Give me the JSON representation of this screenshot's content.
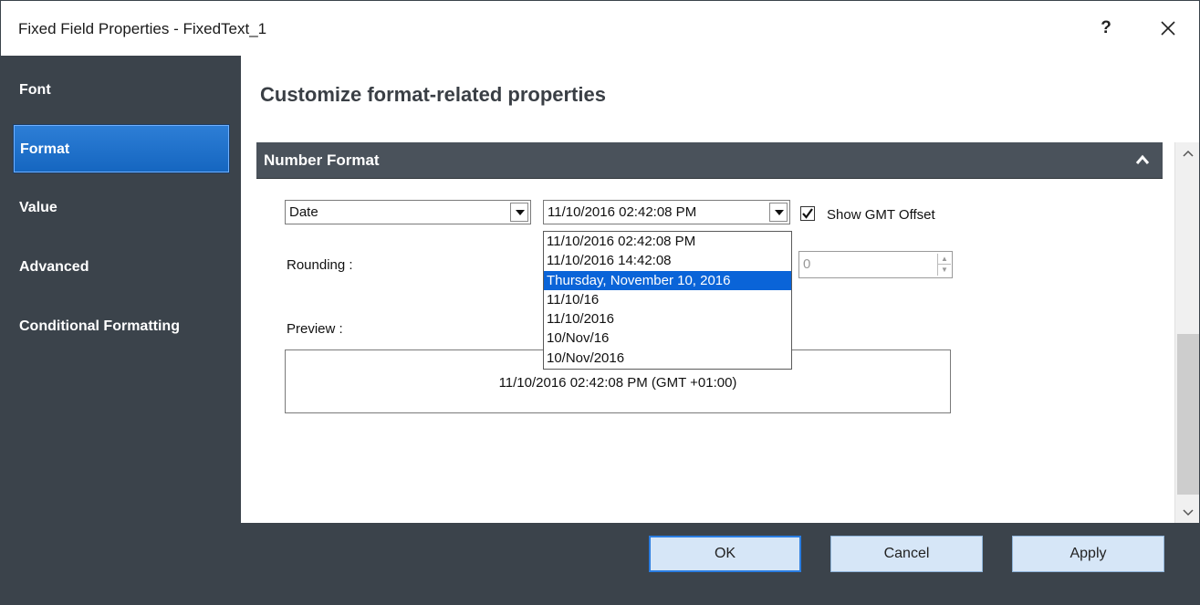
{
  "window": {
    "title": "Fixed Field Properties - FixedText_1",
    "help_label": "?"
  },
  "sidebar": {
    "items": [
      {
        "label": "Font"
      },
      {
        "label": "Format"
      },
      {
        "label": "Value"
      },
      {
        "label": "Advanced"
      },
      {
        "label": "Conditional Formatting"
      }
    ],
    "active": "Format"
  },
  "main": {
    "heading": "Customize format-related properties",
    "section_title": "Number Format",
    "format_type": {
      "value": "Date"
    },
    "format_pattern": {
      "value": "11/10/2016 02:42:08 PM",
      "options": [
        "11/10/2016 02:42:08 PM",
        "11/10/2016 14:42:08",
        "Thursday, November 10, 2016",
        "11/10/16",
        "11/10/2016",
        "10/Nov/16",
        "10/Nov/2016"
      ],
      "highlighted_index": 2
    },
    "show_gmt_offset": {
      "label": "Show GMT Offset",
      "checked": true
    },
    "rounding": {
      "label": "Rounding :",
      "value": "0"
    },
    "preview": {
      "label": "Preview :",
      "text": "11/10/2016 02:42:08 PM (GMT +01:00)"
    }
  },
  "footer": {
    "ok_label": "OK",
    "cancel_label": "Cancel",
    "apply_label": "Apply"
  },
  "colors": {
    "sidebar_bg": "#3b434b",
    "active_nav": "#1a6fcd",
    "section_bar": "#4a525b",
    "selection": "#0a64d8",
    "button_bg": "#d6e6f7"
  }
}
